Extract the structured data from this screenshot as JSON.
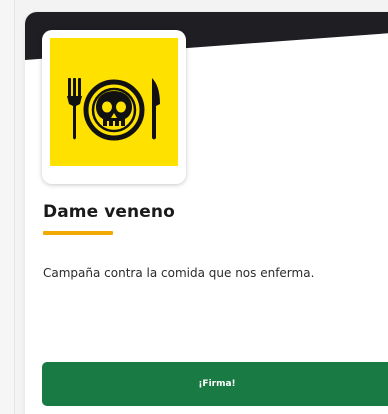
{
  "card": {
    "title": "Dame veneno",
    "description": "Campaña contra la comida que nos enferma.",
    "cta_label": "¡Firma!",
    "logo_icon": "skull-plate-with-fork-and-knife-icon"
  },
  "colors": {
    "banner": "#1f1e23",
    "logo_background": "#ffe100",
    "title_underline": "#f2a900",
    "cta_background": "#1a7a44"
  }
}
